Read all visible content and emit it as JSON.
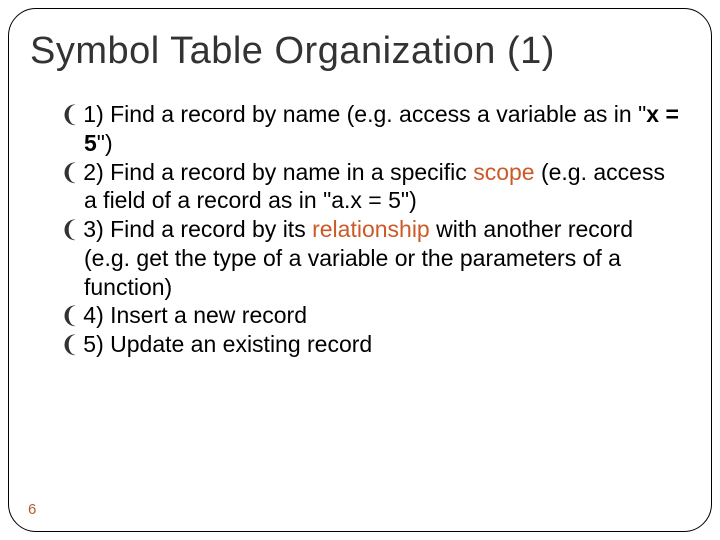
{
  "title": "Symbol Table Organization (1)",
  "bullet_glyph": "❨",
  "items": {
    "i1": {
      "pre": "1) Find a record by name (e.g. access a variable as in \"",
      "bold": "x = 5",
      "post": "\")"
    },
    "i2": {
      "pre": "2) Find a record by name in a specific ",
      "hl": "scope",
      "post": " (e.g. access a field of a record as in \"a.x = 5\")"
    },
    "i3": {
      "pre": "3) Find a record by its ",
      "hl": "relationship",
      "post": " with another record (e.g. get the type of a variable or the parameters of a function)"
    },
    "i4": {
      "text": "4) Insert a new record"
    },
    "i5": {
      "text": "5) Update an existing record"
    }
  },
  "page_number": "6"
}
